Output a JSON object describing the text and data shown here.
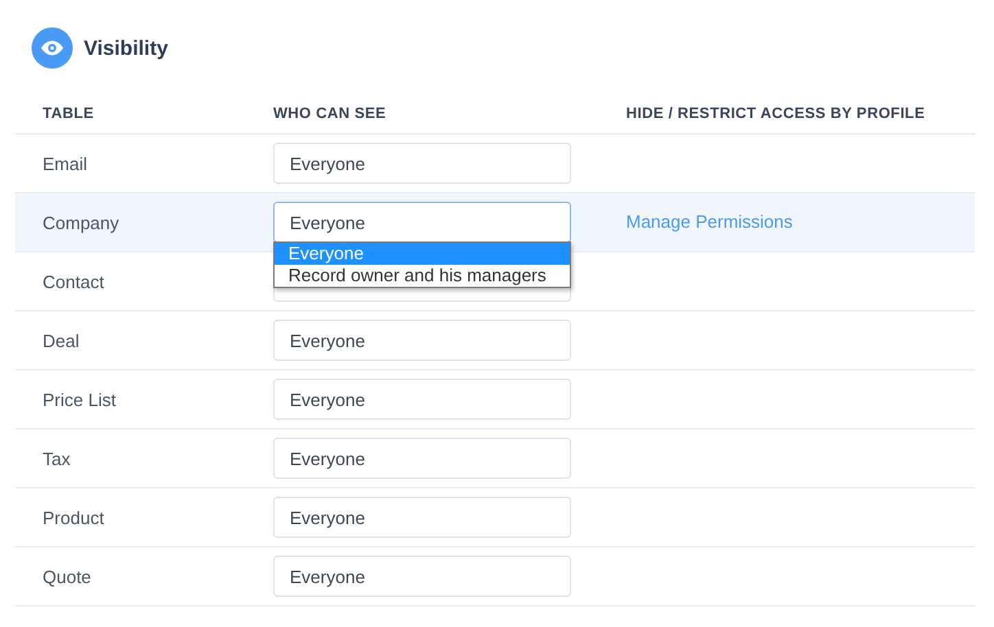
{
  "title": "Visibility",
  "columns": [
    "TABLE",
    "WHO CAN SEE",
    "HIDE / RESTRICT ACCESS BY PROFILE"
  ],
  "rows": [
    {
      "table": "Email",
      "value": "Everyone",
      "selected": false
    },
    {
      "table": "Company",
      "value": "Everyone",
      "selected": true,
      "link": "Manage Permissions",
      "dropdown": [
        {
          "label": "Everyone",
          "selected": true
        },
        {
          "label": "Record owner and his managers",
          "selected": false
        }
      ]
    },
    {
      "table": "Contact",
      "selected": false
    },
    {
      "table": "Deal",
      "value": "Everyone",
      "selected": false
    },
    {
      "table": "Price List",
      "value": "Everyone",
      "selected": false
    },
    {
      "table": "Tax",
      "value": "Everyone",
      "selected": false
    },
    {
      "table": "Product",
      "value": "Everyone",
      "selected": false
    },
    {
      "table": "Quote",
      "value": "Everyone",
      "selected": false
    }
  ]
}
